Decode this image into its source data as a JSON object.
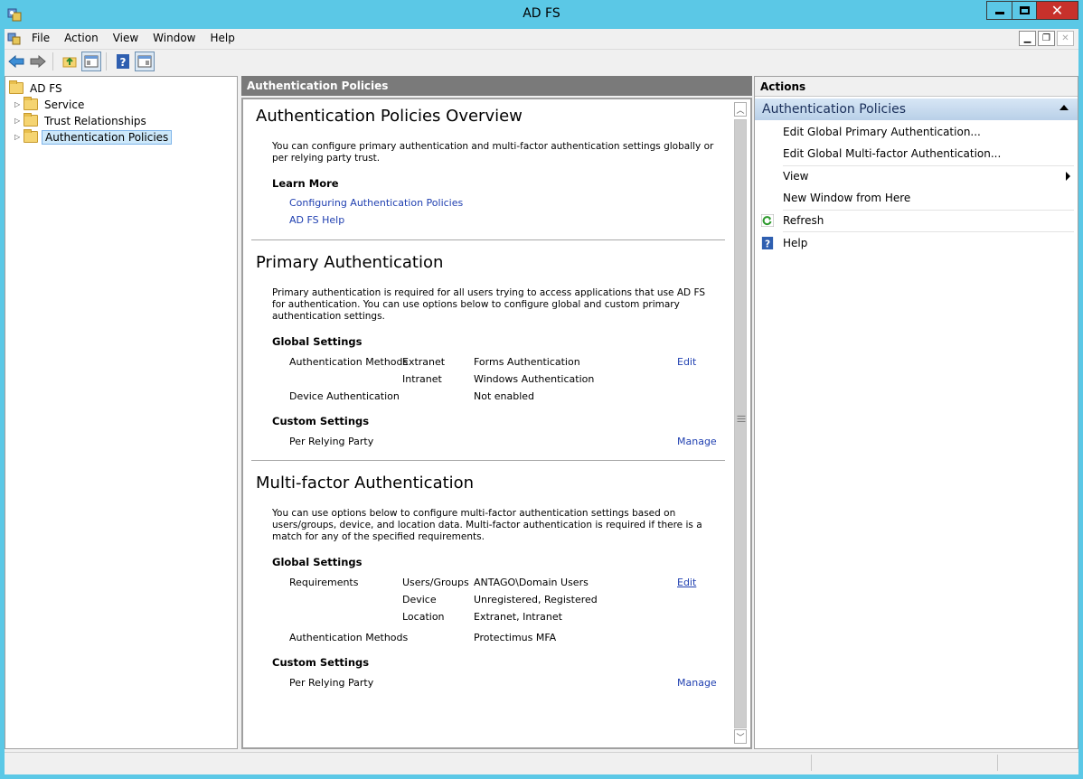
{
  "window": {
    "title": "AD FS",
    "close_glyph": "✕"
  },
  "menu": [
    "File",
    "Action",
    "View",
    "Window",
    "Help"
  ],
  "tree": {
    "root": "AD FS",
    "children": [
      "Service",
      "Trust Relationships",
      "Authentication Policies"
    ],
    "selected": "Authentication Policies"
  },
  "center": {
    "header": "Authentication Policies",
    "overview": {
      "title": "Authentication Policies Overview",
      "description": "You can configure primary authentication and multi-factor authentication settings globally or per relying party trust.",
      "learn_more": "Learn More",
      "links": [
        "Configuring Authentication Policies",
        "AD FS Help"
      ]
    },
    "primary": {
      "title": "Primary Authentication",
      "description": "Primary authentication is required for all users trying to access applications that use AD FS for authentication. You can use options below to configure global and custom primary authentication settings.",
      "global_settings": "Global Settings",
      "auth_methods_label": "Authentication Methods",
      "extranet_label": "Extranet",
      "extranet_value": "Forms Authentication",
      "intranet_label": "Intranet",
      "intranet_value": "Windows Authentication",
      "device_auth_label": "Device Authentication",
      "device_auth_value": "Not enabled",
      "edit_link": "Edit",
      "custom_settings": "Custom Settings",
      "per_rp_label": "Per Relying Party",
      "manage_link": "Manage"
    },
    "mfa": {
      "title": "Multi-factor Authentication",
      "description": "You can use options below to configure multi-factor authentication settings based on users/groups, device, and location data. Multi-factor authentication is required if there is a match for any of the specified requirements.",
      "global_settings": "Global Settings",
      "requirements_label": "Requirements",
      "users_groups_label": "Users/Groups",
      "users_groups_value": "ANTAGO\\Domain Users",
      "device_label": "Device",
      "device_value": "Unregistered, Registered",
      "location_label": "Location",
      "location_value": "Extranet, Intranet",
      "auth_methods_label": "Authentication Methods",
      "auth_methods_value": "Protectimus MFA",
      "edit_link": "Edit",
      "custom_settings": "Custom Settings",
      "per_rp_label": "Per Relying Party",
      "manage_link": "Manage"
    }
  },
  "actions": {
    "header": "Actions",
    "section": "Authentication Policies",
    "items": [
      "Edit Global Primary Authentication...",
      "Edit Global Multi-factor Authentication...",
      "View",
      "New Window from Here",
      "Refresh",
      "Help"
    ]
  },
  "colors": {
    "titlebar": "#5bc8e6",
    "close": "#c7312b",
    "link": "#1f3fb0",
    "section": "#b9d0e8"
  }
}
